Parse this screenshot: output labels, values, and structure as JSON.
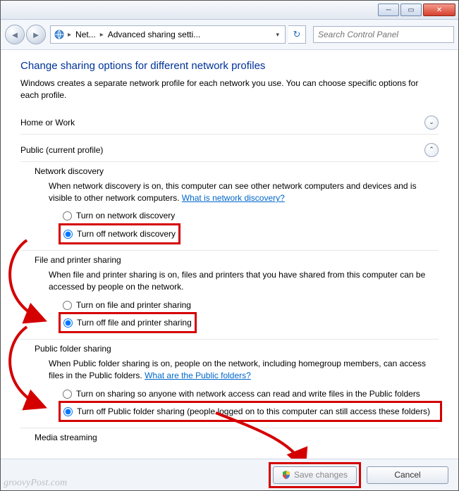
{
  "breadcrumb": {
    "seg1": "Net...",
    "seg2": "Advanced sharing setti..."
  },
  "search_placeholder": "Search Control Panel",
  "page_title": "Change sharing options for different network profiles",
  "page_desc": "Windows creates a separate network profile for each network you use. You can choose specific options for each profile.",
  "profiles": {
    "home": {
      "label": "Home or Work"
    },
    "public": {
      "label": "Public (current profile)"
    }
  },
  "network_discovery": {
    "title": "Network discovery",
    "desc": "When network discovery is on, this computer can see other network computers and devices and is visible to other network computers. ",
    "link": "What is network discovery?",
    "opt_on": "Turn on network discovery",
    "opt_off": "Turn off network discovery"
  },
  "file_printer": {
    "title": "File and printer sharing",
    "desc": "When file and printer sharing is on, files and printers that you have shared from this computer can be accessed by people on the network.",
    "opt_on": "Turn on file and printer sharing",
    "opt_off": "Turn off file and printer sharing"
  },
  "public_folder": {
    "title": "Public folder sharing",
    "desc": "When Public folder sharing is on, people on the network, including homegroup members, can access files in the Public folders. ",
    "link": "What are the Public folders?",
    "opt_on": "Turn on sharing so anyone with network access can read and write files in the Public folders",
    "opt_off": "Turn off Public folder sharing (people logged on to this computer can still access these folders)"
  },
  "media_streaming": {
    "title": "Media streaming"
  },
  "buttons": {
    "save": "Save changes",
    "cancel": "Cancel"
  },
  "watermark": "groovyPost.com"
}
